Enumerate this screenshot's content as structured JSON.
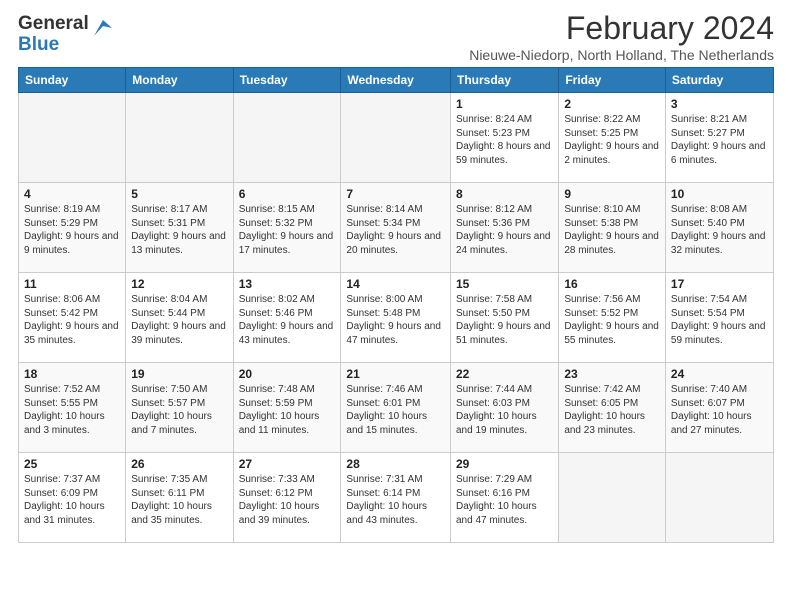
{
  "header": {
    "logo_general": "General",
    "logo_blue": "Blue",
    "title": "February 2024",
    "subtitle": "Nieuwe-Niedorp, North Holland, The Netherlands"
  },
  "weekdays": [
    "Sunday",
    "Monday",
    "Tuesday",
    "Wednesday",
    "Thursday",
    "Friday",
    "Saturday"
  ],
  "weeks": [
    [
      {
        "day": "",
        "detail": ""
      },
      {
        "day": "",
        "detail": ""
      },
      {
        "day": "",
        "detail": ""
      },
      {
        "day": "",
        "detail": ""
      },
      {
        "day": "1",
        "detail": "Sunrise: 8:24 AM\nSunset: 5:23 PM\nDaylight: 8 hours and 59 minutes."
      },
      {
        "day": "2",
        "detail": "Sunrise: 8:22 AM\nSunset: 5:25 PM\nDaylight: 9 hours and 2 minutes."
      },
      {
        "day": "3",
        "detail": "Sunrise: 8:21 AM\nSunset: 5:27 PM\nDaylight: 9 hours and 6 minutes."
      }
    ],
    [
      {
        "day": "4",
        "detail": "Sunrise: 8:19 AM\nSunset: 5:29 PM\nDaylight: 9 hours and 9 minutes."
      },
      {
        "day": "5",
        "detail": "Sunrise: 8:17 AM\nSunset: 5:31 PM\nDaylight: 9 hours and 13 minutes."
      },
      {
        "day": "6",
        "detail": "Sunrise: 8:15 AM\nSunset: 5:32 PM\nDaylight: 9 hours and 17 minutes."
      },
      {
        "day": "7",
        "detail": "Sunrise: 8:14 AM\nSunset: 5:34 PM\nDaylight: 9 hours and 20 minutes."
      },
      {
        "day": "8",
        "detail": "Sunrise: 8:12 AM\nSunset: 5:36 PM\nDaylight: 9 hours and 24 minutes."
      },
      {
        "day": "9",
        "detail": "Sunrise: 8:10 AM\nSunset: 5:38 PM\nDaylight: 9 hours and 28 minutes."
      },
      {
        "day": "10",
        "detail": "Sunrise: 8:08 AM\nSunset: 5:40 PM\nDaylight: 9 hours and 32 minutes."
      }
    ],
    [
      {
        "day": "11",
        "detail": "Sunrise: 8:06 AM\nSunset: 5:42 PM\nDaylight: 9 hours and 35 minutes."
      },
      {
        "day": "12",
        "detail": "Sunrise: 8:04 AM\nSunset: 5:44 PM\nDaylight: 9 hours and 39 minutes."
      },
      {
        "day": "13",
        "detail": "Sunrise: 8:02 AM\nSunset: 5:46 PM\nDaylight: 9 hours and 43 minutes."
      },
      {
        "day": "14",
        "detail": "Sunrise: 8:00 AM\nSunset: 5:48 PM\nDaylight: 9 hours and 47 minutes."
      },
      {
        "day": "15",
        "detail": "Sunrise: 7:58 AM\nSunset: 5:50 PM\nDaylight: 9 hours and 51 minutes."
      },
      {
        "day": "16",
        "detail": "Sunrise: 7:56 AM\nSunset: 5:52 PM\nDaylight: 9 hours and 55 minutes."
      },
      {
        "day": "17",
        "detail": "Sunrise: 7:54 AM\nSunset: 5:54 PM\nDaylight: 9 hours and 59 minutes."
      }
    ],
    [
      {
        "day": "18",
        "detail": "Sunrise: 7:52 AM\nSunset: 5:55 PM\nDaylight: 10 hours and 3 minutes."
      },
      {
        "day": "19",
        "detail": "Sunrise: 7:50 AM\nSunset: 5:57 PM\nDaylight: 10 hours and 7 minutes."
      },
      {
        "day": "20",
        "detail": "Sunrise: 7:48 AM\nSunset: 5:59 PM\nDaylight: 10 hours and 11 minutes."
      },
      {
        "day": "21",
        "detail": "Sunrise: 7:46 AM\nSunset: 6:01 PM\nDaylight: 10 hours and 15 minutes."
      },
      {
        "day": "22",
        "detail": "Sunrise: 7:44 AM\nSunset: 6:03 PM\nDaylight: 10 hours and 19 minutes."
      },
      {
        "day": "23",
        "detail": "Sunrise: 7:42 AM\nSunset: 6:05 PM\nDaylight: 10 hours and 23 minutes."
      },
      {
        "day": "24",
        "detail": "Sunrise: 7:40 AM\nSunset: 6:07 PM\nDaylight: 10 hours and 27 minutes."
      }
    ],
    [
      {
        "day": "25",
        "detail": "Sunrise: 7:37 AM\nSunset: 6:09 PM\nDaylight: 10 hours and 31 minutes."
      },
      {
        "day": "26",
        "detail": "Sunrise: 7:35 AM\nSunset: 6:11 PM\nDaylight: 10 hours and 35 minutes."
      },
      {
        "day": "27",
        "detail": "Sunrise: 7:33 AM\nSunset: 6:12 PM\nDaylight: 10 hours and 39 minutes."
      },
      {
        "day": "28",
        "detail": "Sunrise: 7:31 AM\nSunset: 6:14 PM\nDaylight: 10 hours and 43 minutes."
      },
      {
        "day": "29",
        "detail": "Sunrise: 7:29 AM\nSunset: 6:16 PM\nDaylight: 10 hours and 47 minutes."
      },
      {
        "day": "",
        "detail": ""
      },
      {
        "day": "",
        "detail": ""
      }
    ]
  ]
}
